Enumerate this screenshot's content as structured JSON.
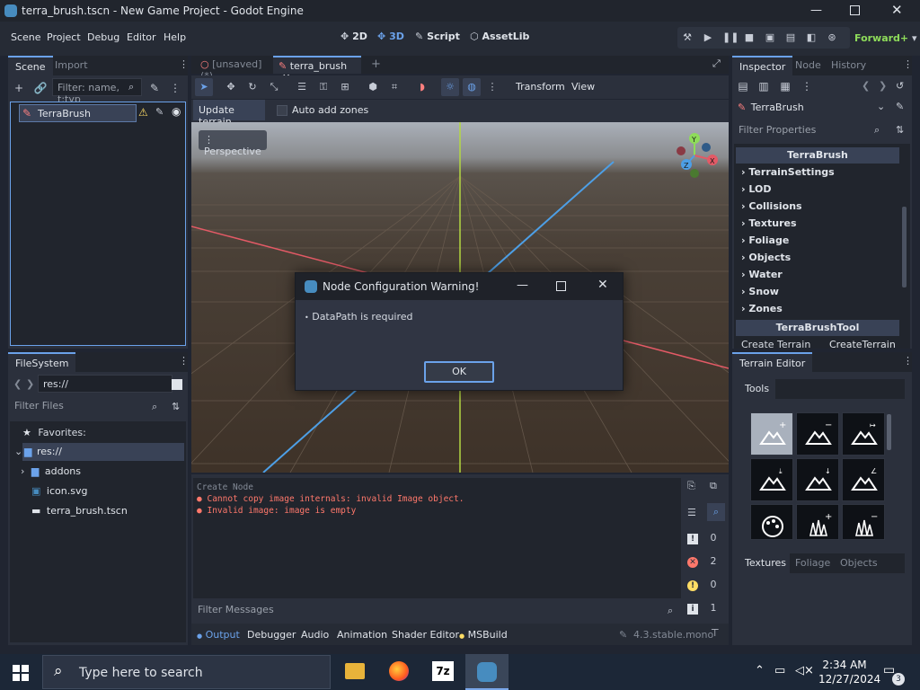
{
  "window": {
    "title": "terra_brush.tscn - New Game Project - Godot Engine"
  },
  "menu": {
    "items": [
      "Scene",
      "Project",
      "Debug",
      "Editor",
      "Help"
    ]
  },
  "workspaces": {
    "b2d": "2D",
    "b3d": "3D",
    "script": "Script",
    "assetlib": "AssetLib"
  },
  "renderer": "Forward+",
  "scene_dock": {
    "tabs": [
      "Scene",
      "Import"
    ],
    "filter_placeholder": "Filter: name, t:typ",
    "root_node": "TerraBrush"
  },
  "filesystem": {
    "tab": "FileSystem",
    "path": "res://",
    "filter_placeholder": "Filter Files",
    "favorites_label": "Favorites:",
    "root": "res://",
    "items": [
      "addons",
      "icon.svg",
      "terra_brush.tscn"
    ]
  },
  "editor_tabs": {
    "unsaved": "[unsaved](*)",
    "current": "terra_brush"
  },
  "viewport_toolbar": {
    "transform": "Transform",
    "view": "View",
    "update_terrain": "Update terrain",
    "auto_add_zones": "Auto add zones"
  },
  "viewport": {
    "perspective_label": "Perspective"
  },
  "dialog": {
    "title": "Node Configuration Warning!",
    "message": "DataPath is required",
    "ok_label": "OK"
  },
  "output": {
    "header": "Create Node",
    "lines": [
      {
        "text": "Cannot copy image internals: invalid Image object.",
        "level": "error"
      },
      {
        "text": "Invalid image: image is empty",
        "level": "error"
      }
    ],
    "filter_placeholder": "Filter Messages",
    "counts": {
      "messages": "0",
      "errors": "2",
      "warnings": "0",
      "info": "1"
    },
    "bottom_tabs": [
      "Output",
      "Debugger",
      "Audio",
      "Animation",
      "Shader Editor",
      "MSBuild"
    ],
    "version": "4.3.stable.mono"
  },
  "inspector": {
    "tabs": [
      "Inspector",
      "Node",
      "History"
    ],
    "node_name": "TerraBrush",
    "filter_placeholder": "Filter Properties",
    "section_title": "TerraBrush",
    "groups": [
      "TerrainSettings",
      "LOD",
      "Collisions",
      "Textures",
      "Foliage",
      "Objects",
      "Water",
      "Snow",
      "Zones"
    ],
    "tool_section": "TerraBrushTool",
    "tool_prop_label": "Create Terrain",
    "tool_prop_value": "CreateTerrain"
  },
  "terrain_editor": {
    "tab": "Terrain Editor",
    "tools_tab": "Tools",
    "bottom_tabs": [
      "Textures",
      "Foliage",
      "Objects"
    ]
  },
  "taskbar": {
    "search_placeholder": "Type here to search",
    "time": "2:34 AM",
    "date": "12/27/2024",
    "notification_count": "3",
    "apps": [
      "file-explorer",
      "firefox",
      "7zip",
      "godot"
    ]
  },
  "colors": {
    "accent": "#6ba2ea",
    "error": "#ff786b",
    "warning": "#ffdd65",
    "background": "#202531"
  }
}
